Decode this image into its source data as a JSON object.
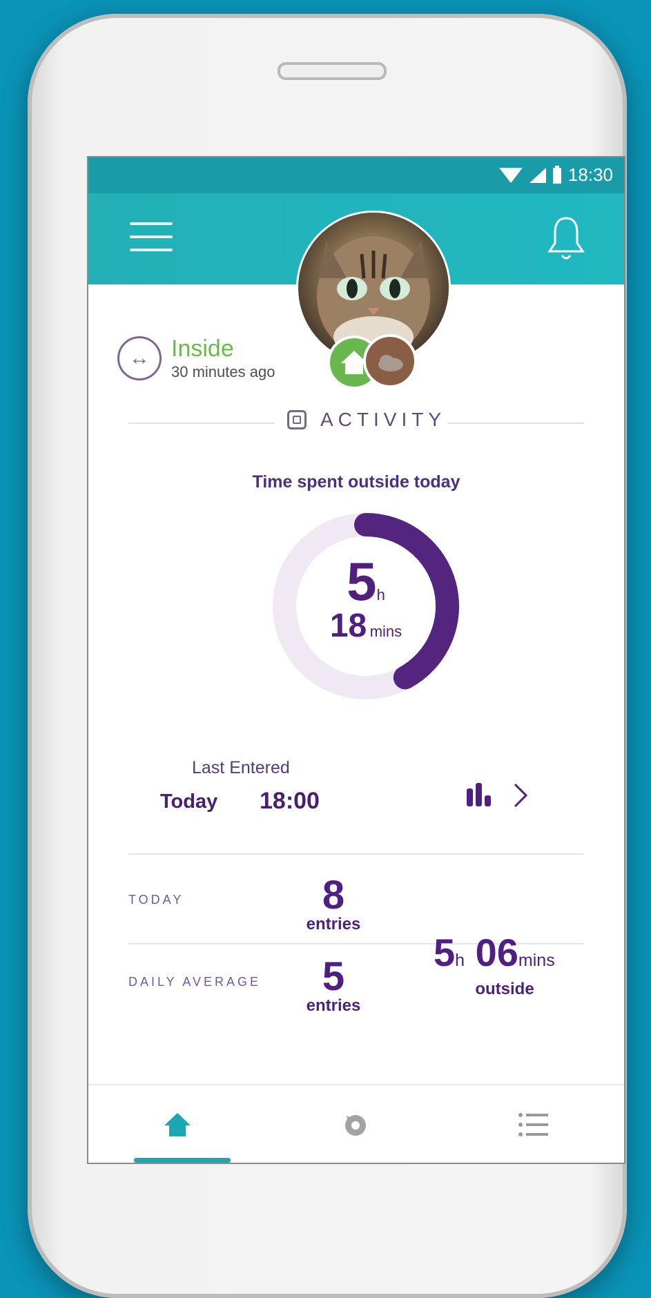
{
  "status": {
    "time": "18:30"
  },
  "location": {
    "status": "Inside",
    "time": "30 minutes ago"
  },
  "activity": {
    "section_title": "ACTIVITY",
    "time_outside_title": "Time spent outside today",
    "hours": "5",
    "hours_unit": "h",
    "minutes": "18",
    "minutes_unit": "mins",
    "ring_progress_fraction": 0.42
  },
  "last_entered": {
    "label": "Last Entered",
    "day": "Today",
    "time": "18:00"
  },
  "today": {
    "label": "TODAY",
    "entries": "8",
    "entries_label": "entries"
  },
  "daily_average": {
    "label": "DAILY AVERAGE",
    "entries": "5",
    "entries_label": "entries",
    "hours": "5",
    "hours_unit": "h",
    "minutes": "06",
    "minutes_unit": "mins",
    "time_label": "outside"
  },
  "nav": {
    "items": [
      "home",
      "pet-feeder",
      "list"
    ],
    "active": "home"
  },
  "colors": {
    "accent": "#1ba8b3",
    "purple": "#51207f",
    "green": "#68b84f",
    "header": "#21b8c1"
  }
}
